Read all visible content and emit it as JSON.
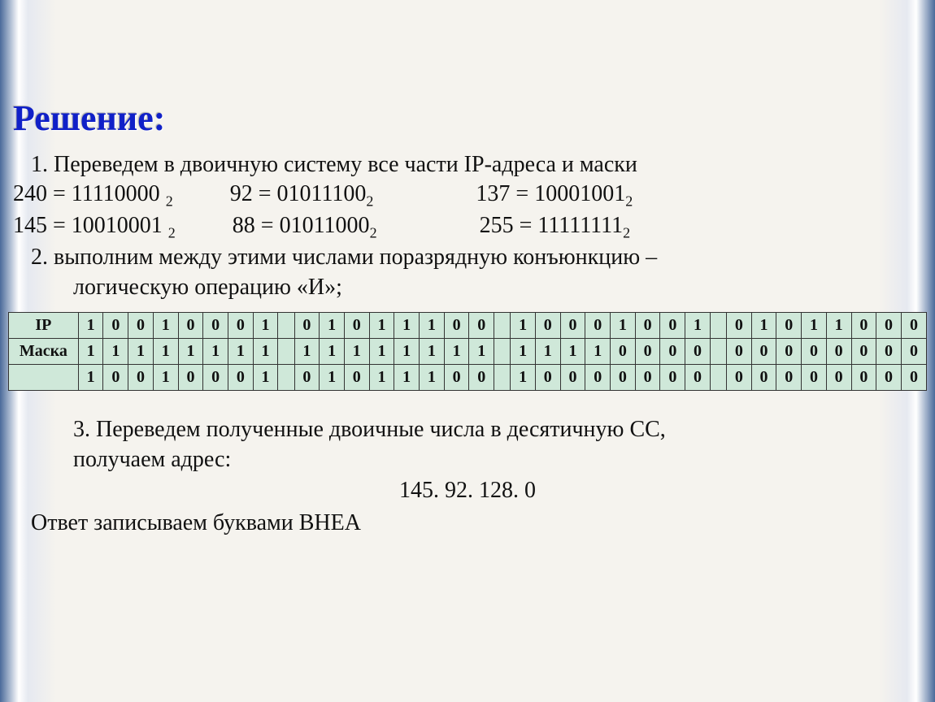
{
  "title": "Решение:",
  "step1": "1.   Переведем в двоичную систему все части IP-адреса и маски",
  "conversions": {
    "line1": {
      "a": "240 = 11110000 ",
      "a_sub": "2",
      "b": "92 = 01011100",
      "b_sub": "2",
      "c": "137 = 10001001",
      "c_sub": "2"
    },
    "line2": {
      "a": "145 = 10010001 ",
      "a_sub": "2",
      "b": "88 = 01011000",
      "b_sub": "2",
      "c": "255 = 11111111",
      "c_sub": "2"
    }
  },
  "step2a": "2.   выполним между этими числами поразрядную конъюнкцию –",
  "step2b": "     логическую операцию «И»;",
  "table": {
    "rows": [
      {
        "label": "IP",
        "octets": [
          [
            "1",
            "0",
            "0",
            "1",
            "0",
            "0",
            "0",
            "1"
          ],
          [
            "0",
            "1",
            "0",
            "1",
            "1",
            "1",
            "0",
            "0"
          ],
          [
            "1",
            "0",
            "0",
            "0",
            "1",
            "0",
            "0",
            "1"
          ],
          [
            "0",
            "1",
            "0",
            "1",
            "1",
            "0",
            "0",
            "0"
          ]
        ]
      },
      {
        "label": "Маска",
        "octets": [
          [
            "1",
            "1",
            "1",
            "1",
            "1",
            "1",
            "1",
            "1"
          ],
          [
            "1",
            "1",
            "1",
            "1",
            "1",
            "1",
            "1",
            "1"
          ],
          [
            "1",
            "1",
            "1",
            "1",
            "0",
            "0",
            "0",
            "0"
          ],
          [
            "0",
            "0",
            "0",
            "0",
            "0",
            "0",
            "0",
            "0"
          ]
        ]
      },
      {
        "label": "",
        "octets": [
          [
            "1",
            "0",
            "0",
            "1",
            "0",
            "0",
            "0",
            "1"
          ],
          [
            "0",
            "1",
            "0",
            "1",
            "1",
            "1",
            "0",
            "0"
          ],
          [
            "1",
            "0",
            "0",
            "0",
            "0",
            "0",
            "0",
            "0"
          ],
          [
            "0",
            "0",
            "0",
            "0",
            "0",
            "0",
            "0",
            "0"
          ]
        ]
      }
    ]
  },
  "step3a": "3.   Переведем полученные двоичные числа в десятичную СС,",
  "step3b": "     получаем адрес:",
  "result_address": "145. 92. 128. 0",
  "answer": "Ответ записываем буквами  ВНЕА"
}
